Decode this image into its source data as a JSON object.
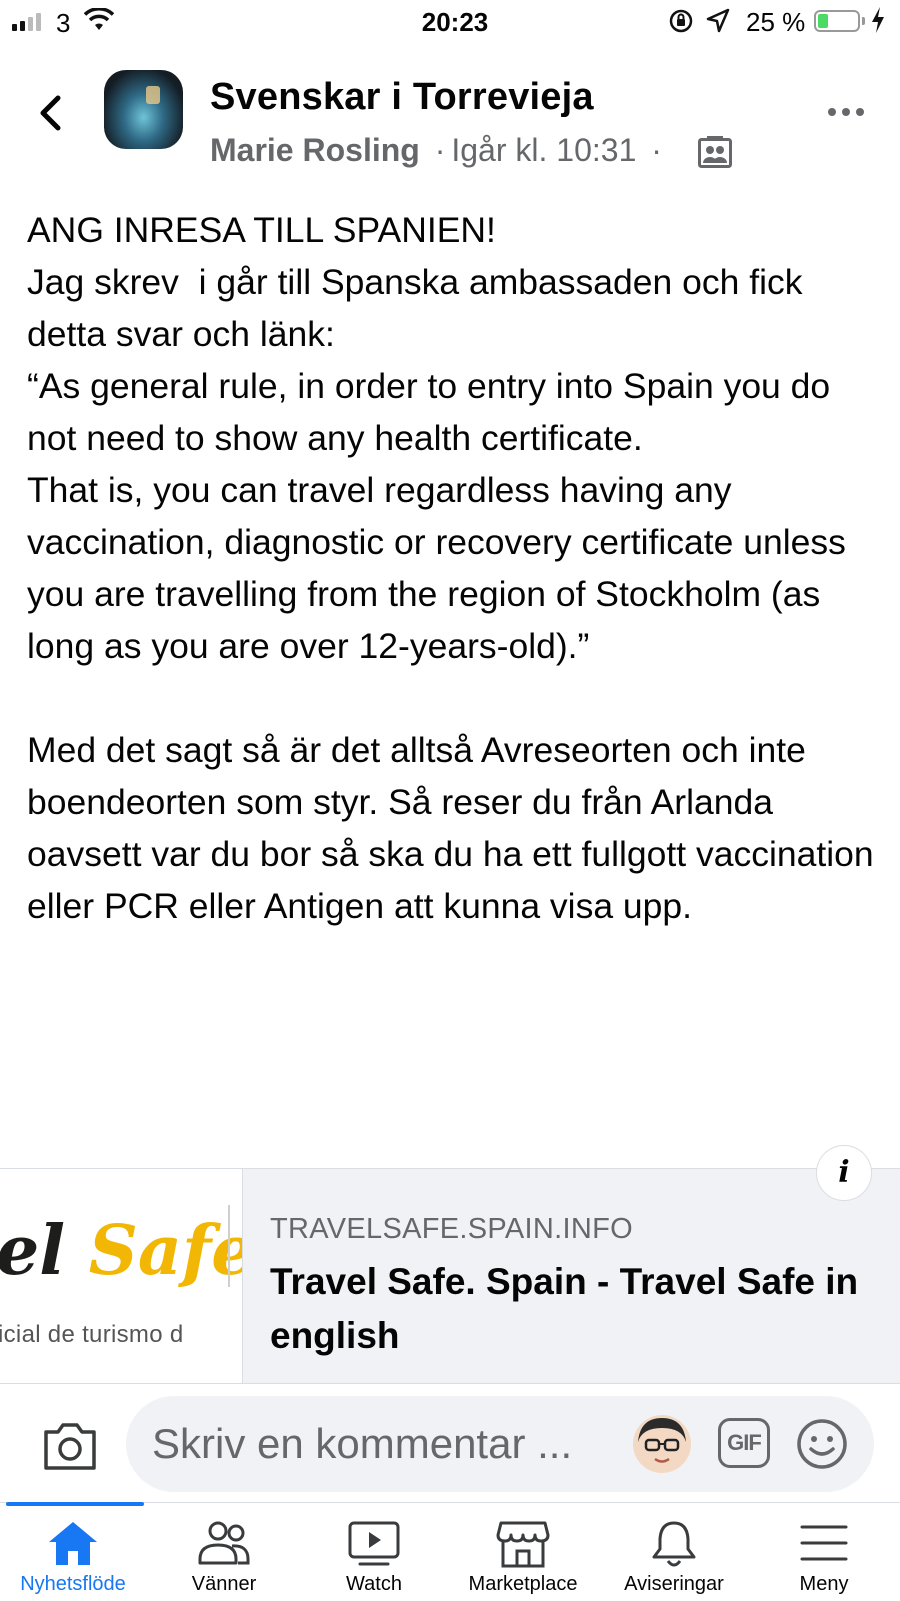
{
  "status_bar": {
    "carrier": "3",
    "time": "20:23",
    "battery_percent": "25 %",
    "battery_level": 0.25
  },
  "header": {
    "group_name": "Svenskar i Torrevieja",
    "author": "Marie Rosling",
    "separator": "·",
    "timestamp": "Igår kl. 10:31",
    "icons": {
      "back": "chevron-left-icon",
      "more": "more-horizontal-icon",
      "audience": "members-group-icon"
    }
  },
  "post": {
    "text": "ANG INRESA TILL SPANIEN!\nJag skrev  i går till Spanska ambassaden och fick detta svar och länk:\n“As general rule, in order to entry into Spain you do not need to show any health certificate.\nThat is, you can travel regardless having any vaccination, diagnostic or recovery certificate unless you are travelling from the region of Stockholm (as long as you are over 12-years-old).”\n\nMed det sagt så är det alltså Avreseorten och inte boendeorten som styr. Så reser du från Arlanda oavsett var du bor så ska du ha ett fullgott vaccination eller PCR eller Antigen att kunna visa upp."
  },
  "link_preview": {
    "thumbnail_logo_prefix": "el",
    "thumbnail_logo": "Safe",
    "thumbnail_tagline": "icial de turismo d",
    "domain": "TRAVELSAFE.SPAIN.INFO",
    "title": "Travel Safe. Spain - Travel Safe in english",
    "info_label": "i"
  },
  "comment_bar": {
    "placeholder": "Skriv en kommentar ...",
    "gif_label": "GIF",
    "icons": {
      "camera": "camera-icon",
      "avatar": "user-avatar",
      "emoji": "emoji-smile-icon"
    }
  },
  "tab_bar": {
    "active_index": 0,
    "accent_color": "#1877f2",
    "tabs": [
      {
        "label": "Nyhetsflöde",
        "icon": "home-icon"
      },
      {
        "label": "Vänner",
        "icon": "friends-icon"
      },
      {
        "label": "Watch",
        "icon": "watch-icon"
      },
      {
        "label": "Marketplace",
        "icon": "marketplace-icon"
      },
      {
        "label": "Aviseringar",
        "icon": "bell-icon"
      },
      {
        "label": "Meny",
        "icon": "menu-icon"
      }
    ]
  }
}
